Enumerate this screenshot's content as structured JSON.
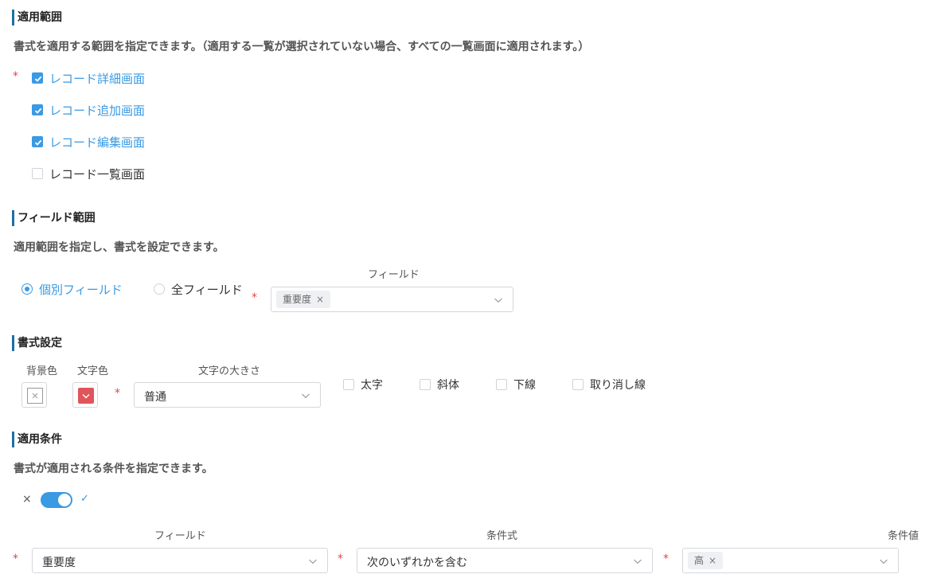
{
  "scope_section": {
    "title": "適用範囲",
    "description": "書式を適用する範囲を指定できます。（適用する一覧が選択されていない場合、すべての一覧画面に適用されます。）",
    "required_mark": "*",
    "options": [
      {
        "label": "レコード詳細画面",
        "checked": true
      },
      {
        "label": "レコード追加画面",
        "checked": true
      },
      {
        "label": "レコード編集画面",
        "checked": true
      },
      {
        "label": "レコード一覧画面",
        "checked": false
      }
    ]
  },
  "field_section": {
    "title": "フィールド範囲",
    "description": "適用範囲を指定し、書式を設定できます。",
    "radio_individual": "個別フィールド",
    "radio_all": "全フィールド",
    "selected_radio": "individual",
    "field_label": "フィールド",
    "required_mark": "*",
    "selected_tag": "重要度",
    "tag_remove": "×"
  },
  "format_section": {
    "title": "書式設定",
    "bg_color_label": "背景色",
    "text_color_label": "文字色",
    "text_color_value": "#e0555a",
    "font_size_label": "文字の大きさ",
    "required_mark": "*",
    "font_size_value": "普通",
    "styles": [
      {
        "label": "太字",
        "checked": false
      },
      {
        "label": "斜体",
        "checked": false
      },
      {
        "label": "下線",
        "checked": false
      },
      {
        "label": "取り消し線",
        "checked": false
      }
    ]
  },
  "condition_section": {
    "title": "適用条件",
    "description": "書式が適用される条件を指定できます。",
    "toggle_off_icon": "×",
    "toggle_on_icon": "✓",
    "toggle_on": true,
    "field_label": "フィールド",
    "expression_label": "条件式",
    "value_label": "条件値",
    "required_mark": "*",
    "field_value": "重要度",
    "expression_value": "次のいずれかを含む",
    "value_tag": "高",
    "tag_remove": "×"
  },
  "colors": {
    "accent": "#3a9ae3",
    "section_bar": "#1f6fa3",
    "required": "#e64545"
  }
}
